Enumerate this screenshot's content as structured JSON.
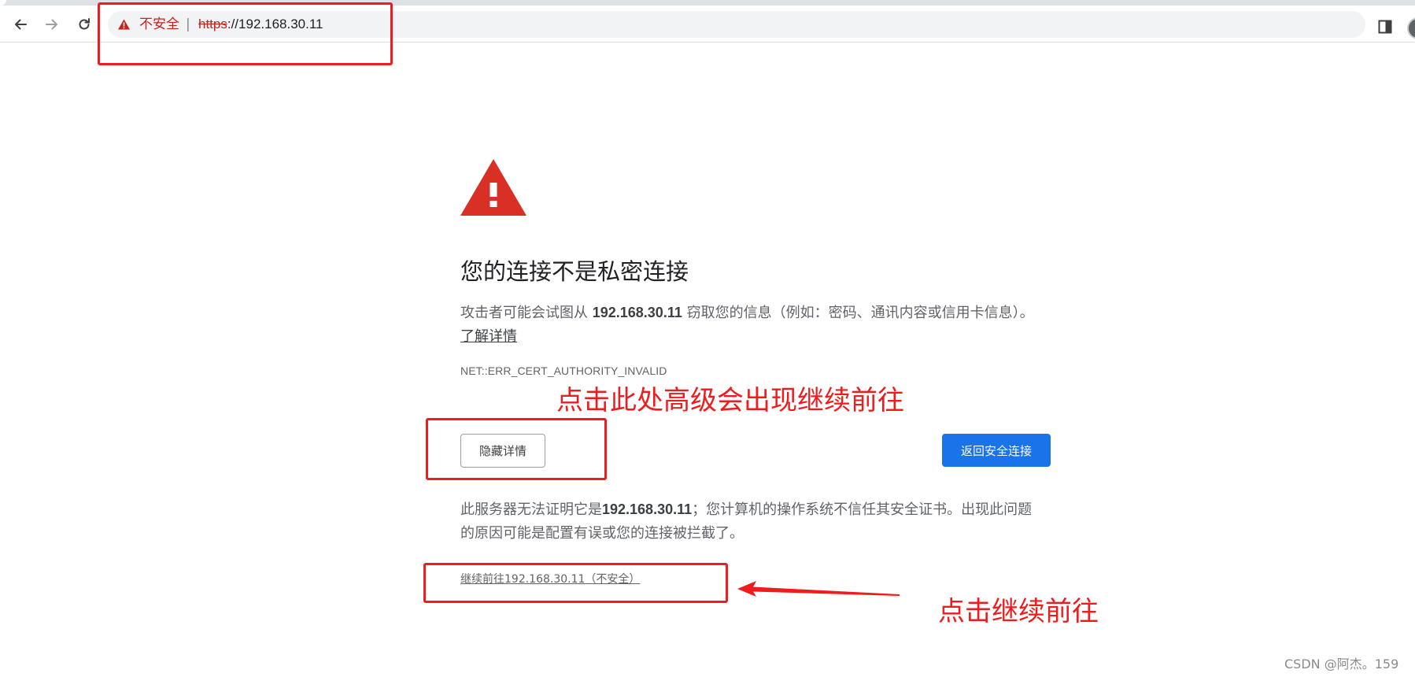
{
  "browser": {
    "omnibox": {
      "security_label": "不安全",
      "separator": "|",
      "url_scheme": "https",
      "url_rest": "://192.168.30.11"
    },
    "icons": {
      "back": "arrow-left-icon",
      "forward": "arrow-right-icon",
      "reload": "reload-icon",
      "security": "warning-triangle-icon",
      "side_panel": "side-panel-icon",
      "profile": "avatar-icon"
    }
  },
  "interstitial": {
    "heading": "您的连接不是私密连接",
    "description_prefix": "攻击者可能会试图从",
    "description_host": "192.168.30.11",
    "description_suffix": "窃取您的信息（例如：密码、通讯内容或信用卡信息）。",
    "learn_more": "了解详情",
    "error_code": "NET::ERR_CERT_AUTHORITY_INVALID",
    "hide_details_button": "隐藏详情",
    "back_button": "返回安全连接",
    "details_prefix": "此服务器无法证明它是",
    "details_host": "192.168.30.11",
    "details_suffix": "；您计算机的操作系统不信任其安全证书。出现此问题的原因可能是配置有误或您的连接被拦截了。",
    "proceed_link": "继续前往192.168.30.11（不安全）"
  },
  "annotations": {
    "advanced_hint": "点击此处高级会出现继续前往",
    "proceed_hint": "点击继续前往",
    "color": "#ee1c1c"
  },
  "watermark": "CSDN @阿杰。159",
  "colors": {
    "danger": "#d93025",
    "primary_button": "#1a73e8",
    "insecure_text": "#c5221f"
  }
}
